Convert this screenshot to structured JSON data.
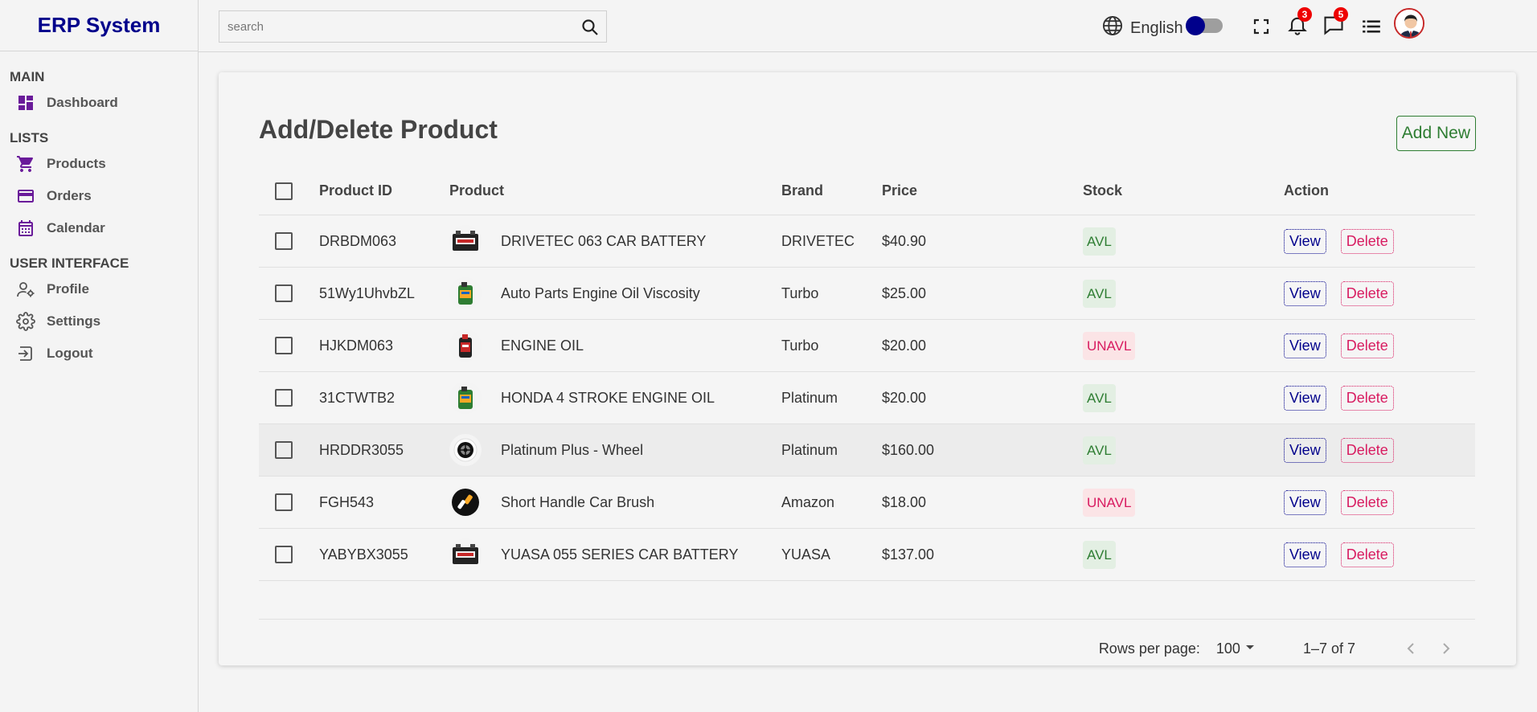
{
  "app": {
    "title": "ERP System"
  },
  "sidebar": {
    "sections": [
      {
        "title": "MAIN",
        "items": [
          {
            "label": "Dashboard",
            "icon": "dashboard-icon"
          }
        ]
      },
      {
        "title": "LISTS",
        "items": [
          {
            "label": "Products",
            "icon": "cart-icon"
          },
          {
            "label": "Orders",
            "icon": "credit-card-icon"
          },
          {
            "label": "Calendar",
            "icon": "calendar-icon"
          }
        ]
      },
      {
        "title": "USER INTERFACE",
        "items": [
          {
            "label": "Profile",
            "icon": "profile-icon"
          },
          {
            "label": "Settings",
            "icon": "gear-icon"
          },
          {
            "label": "Logout",
            "icon": "logout-icon"
          }
        ]
      }
    ]
  },
  "topbar": {
    "search_placeholder": "search",
    "language": "English",
    "notifications_count": "3",
    "messages_count": "5"
  },
  "page": {
    "title": "Add/Delete Product",
    "add_new_label": "Add New"
  },
  "table": {
    "headers": {
      "id": "Product ID",
      "product": "Product",
      "brand": "Brand",
      "price": "Price",
      "stock": "Stock",
      "action": "Action"
    },
    "view_label": "View",
    "delete_label": "Delete",
    "rows": [
      {
        "id": "DRBDM063",
        "product": "DRIVETEC 063 CAR BATTERY",
        "brand": "DRIVETEC",
        "price": "$40.90",
        "stock": "AVL",
        "thumb": "battery"
      },
      {
        "id": "51Wy1UhvbZL",
        "product": "Auto Parts Engine Oil Viscosity",
        "brand": "Turbo",
        "price": "$25.00",
        "stock": "AVL",
        "thumb": "oil"
      },
      {
        "id": "HJKDM063",
        "product": "ENGINE OIL",
        "brand": "Turbo",
        "price": "$20.00",
        "stock": "UNAVL",
        "thumb": "oil-red"
      },
      {
        "id": "31CTWTB2",
        "product": "HONDA 4 STROKE ENGINE OIL",
        "brand": "Platinum",
        "price": "$20.00",
        "stock": "AVL",
        "thumb": "oil"
      },
      {
        "id": "HRDDR3055",
        "product": "Platinum Plus - Wheel",
        "brand": "Platinum",
        "price": "$160.00",
        "stock": "AVL",
        "thumb": "wheel"
      },
      {
        "id": "FGH543",
        "product": "Short Handle Car Brush",
        "brand": "Amazon",
        "price": "$18.00",
        "stock": "UNAVL",
        "thumb": "brush"
      },
      {
        "id": "YABYBX3055",
        "product": "YUASA 055 SERIES CAR BATTERY",
        "brand": "YUASA",
        "price": "$137.00",
        "stock": "AVL",
        "thumb": "battery"
      }
    ]
  },
  "pagination": {
    "rows_per_page_label": "Rows per page:",
    "rows_per_page_value": "100",
    "range": "1–7 of 7"
  },
  "colors": {
    "brand": "#00008b",
    "sidebar_icon": "#6a1b9a",
    "avl_text": "#2e7d32",
    "unavl_text": "#d81b60"
  }
}
